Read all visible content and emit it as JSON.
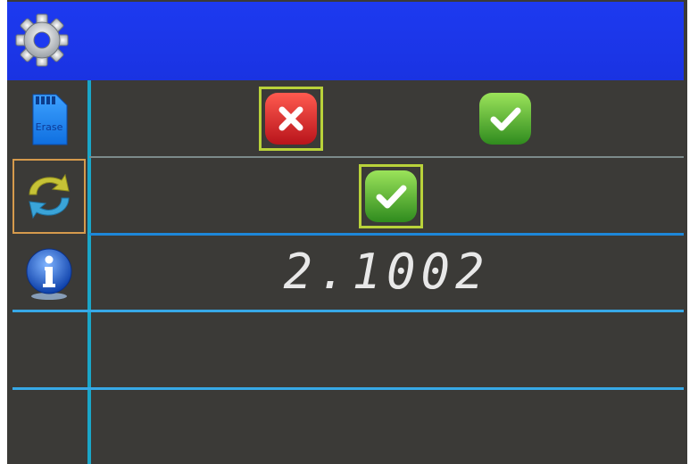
{
  "screen": {
    "colors": {
      "background": "#3b3a37",
      "topbar": "#1d3af0",
      "divider": "#1e87d8",
      "selection_frame": "#b9d23a",
      "selected_side_border": "#d59a4c",
      "cancel_red": "#d8262e",
      "confirm_green": "#5bb82a"
    }
  },
  "topbar": {
    "icon": "gear-icon"
  },
  "sidebar": {
    "items": [
      {
        "icon": "sd-card-erase-icon",
        "label": "Erase"
      },
      {
        "icon": "refresh-arrows-icon"
      },
      {
        "icon": "info-icon"
      }
    ]
  },
  "rows": {
    "erase": {
      "cancel_icon": "cancel-x-icon",
      "confirm_icon": "confirm-check-icon"
    },
    "refresh": {
      "confirm_icon": "confirm-check-icon"
    },
    "info": {
      "version": "2.1002"
    }
  }
}
